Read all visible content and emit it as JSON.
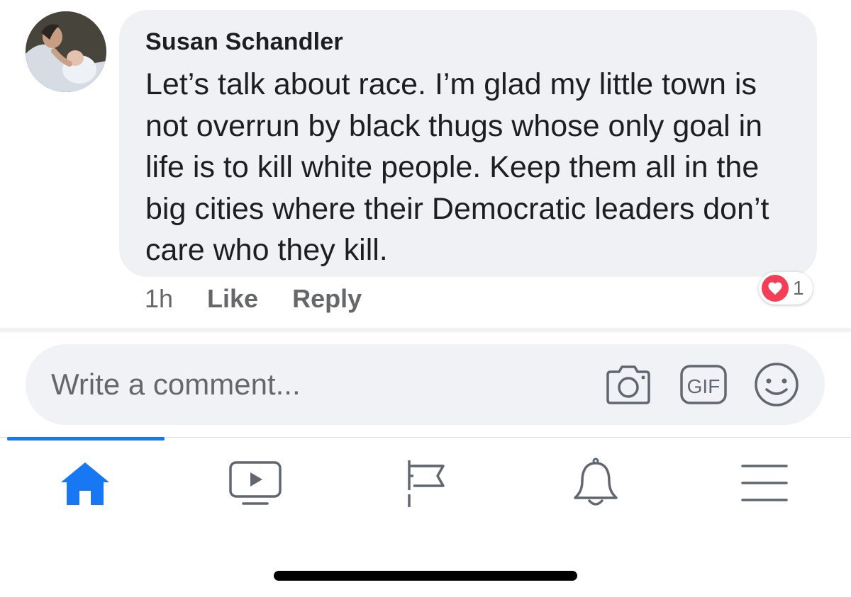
{
  "comment": {
    "author": "Susan Schandler",
    "text": "Let’s talk about race. I’m glad my little town is not overrun by black thugs whose only goal in life is to kill white people. Keep them all in the big cities where their Democratic leaders don’t care who they kill.",
    "time": "1h",
    "like_label": "Like",
    "reply_label": "Reply",
    "reaction_icon": "love-heart-icon",
    "reaction_count": "1"
  },
  "composer": {
    "placeholder": "Write a comment...",
    "icons": [
      "camera-icon",
      "gif-icon",
      "emoji-icon"
    ],
    "gif_label": "GIF"
  },
  "tabbar": {
    "active_tab": "home",
    "tabs": [
      "home-icon",
      "watch-icon",
      "pages-icon",
      "notifications-icon",
      "menu-icon"
    ]
  },
  "colors": {
    "accent": "#1877f2",
    "reaction": "#f33e58",
    "bubble": "#eff1f4",
    "secondary_text": "#65676b"
  }
}
